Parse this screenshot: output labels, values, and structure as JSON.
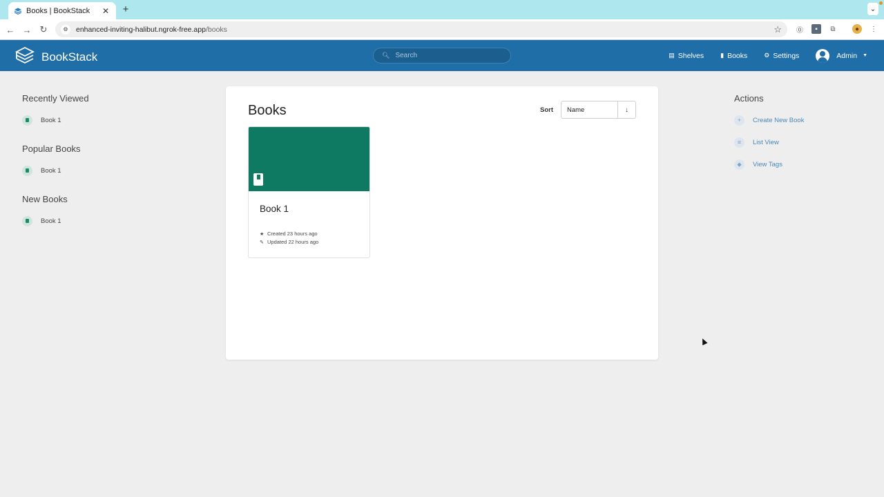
{
  "browser": {
    "tab_title": "Books | BookStack",
    "tab_close": "✕",
    "new_tab": "+",
    "url_domain": "enhanced-inviting-halibut.ngrok-free.app",
    "url_path": "/books"
  },
  "header": {
    "app_name": "BookStack",
    "search_placeholder": "Search",
    "nav": {
      "shelves": "Shelves",
      "books": "Books",
      "settings": "Settings",
      "user": "Admin"
    }
  },
  "left": {
    "recently_viewed": {
      "title": "Recently Viewed",
      "items": [
        "Book 1"
      ]
    },
    "popular_books": {
      "title": "Popular Books",
      "items": [
        "Book 1"
      ]
    },
    "new_books": {
      "title": "New Books",
      "items": [
        "Book 1"
      ]
    }
  },
  "main": {
    "title": "Books",
    "sort_label": "Sort",
    "sort_value": "Name",
    "sort_direction": "↓",
    "books": [
      {
        "name": "Book 1",
        "created": "Created 23 hours ago",
        "updated": "Updated 22 hours ago",
        "cover_color": "#0f7a62"
      }
    ]
  },
  "actions": {
    "title": "Actions",
    "create": "Create New Book",
    "list_view": "List View",
    "view_tags": "View Tags"
  },
  "colors": {
    "header_bg": "#206ea7",
    "tabbar_bg": "#aee8ee",
    "accent_link": "#4a88b8",
    "book_green": "#0f7a62"
  }
}
